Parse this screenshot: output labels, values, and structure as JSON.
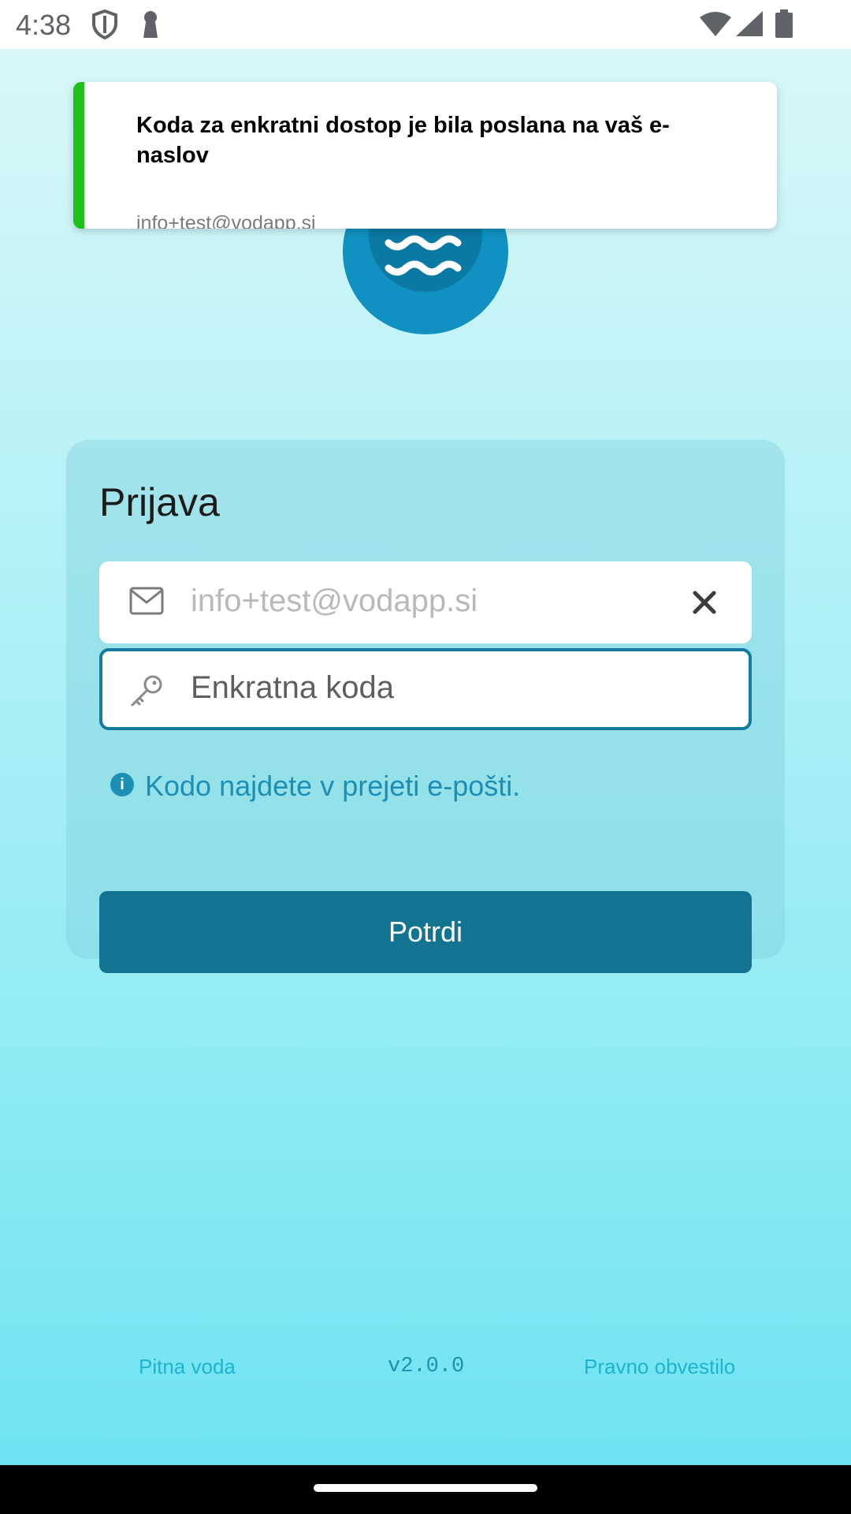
{
  "status_bar": {
    "time": "4:38"
  },
  "toast": {
    "title": "Koda za enkratni dostop je bila poslana na vaš e-naslov",
    "message": "info+test@vodapp.si",
    "accent_color": "#1fc11a"
  },
  "login": {
    "title": "Prijava",
    "email": {
      "value": "info+test@vodapp.si",
      "icon": "mail-icon"
    },
    "code": {
      "placeholder": "Enkratna koda",
      "icon": "key-icon"
    },
    "hint": "Kodo najdete v prejeti e-pošti.",
    "confirm_label": "Potrdi"
  },
  "footer": {
    "left_link": "Pitna voda",
    "version": "v2.0.0",
    "right_link": "Pravno obvestilo"
  },
  "colors": {
    "primary": "#127491",
    "hint": "#1d8fb5",
    "footer_link": "#1fb3cf"
  }
}
